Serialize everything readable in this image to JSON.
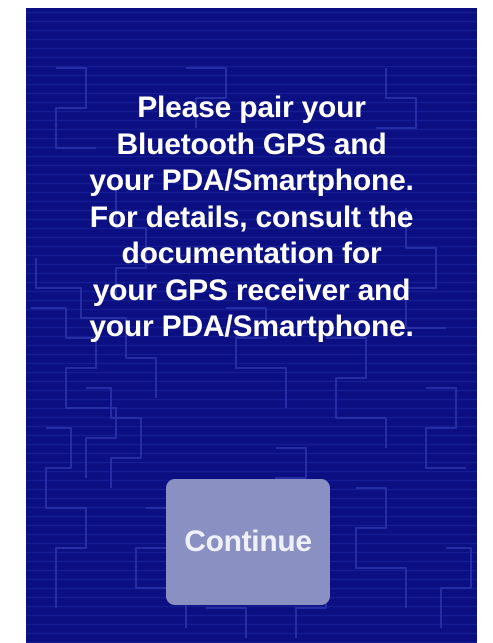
{
  "dialog": {
    "message_lines": [
      "Please pair your",
      "Bluetooth GPS and",
      "your PDA/Smartphone.",
      "For details, consult the",
      "documentation for",
      "your GPS receiver and",
      "your PDA/Smartphone."
    ],
    "continue_label": "Continue"
  },
  "colors": {
    "background": "#0b0f82",
    "pattern_line": "#2a31a8",
    "text": "#ffffff",
    "button_fill": "#8b90c2",
    "button_text": "#eef0fb"
  }
}
